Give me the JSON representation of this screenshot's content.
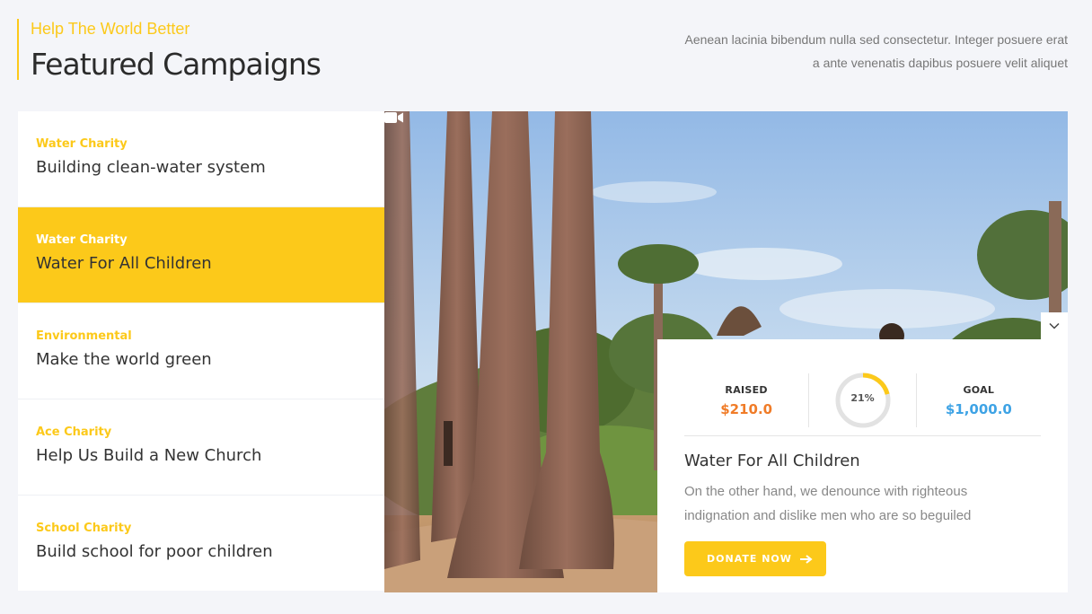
{
  "header": {
    "subtitle": "Help The World Better",
    "title": "Featured Campaigns",
    "description_line1": "Aenean lacinia bibendum nulla sed consectetur. Integer posuere erat",
    "description_line2": "a ante venenatis dapibus posuere velit aliquet"
  },
  "campaigns": [
    {
      "category": "Water Charity",
      "title": "Building clean-water system"
    },
    {
      "category": "Water Charity",
      "title": "Water For All Children"
    },
    {
      "category": "Environmental",
      "title": "Make the world green"
    },
    {
      "category": "Ace Charity",
      "title": "Help Us Build a New Church"
    },
    {
      "category": "School Charity",
      "title": "Build school for poor children"
    }
  ],
  "active_campaign_index": 1,
  "card": {
    "raised_label": "RAISED",
    "raised_value": "$210.0",
    "progress_text": "21%",
    "progress": 0.21,
    "goal_label": "GOAL",
    "goal_value": "$1,000.0",
    "title": "Water For All Children",
    "description": "On the other hand, we denounce with righteous indignation and dislike men who are so beguiled",
    "donate_label": "DONATE NOW"
  },
  "colors": {
    "accent": "#fcc91a",
    "raised": "#f07c28",
    "goal": "#3ea3e5",
    "ring_track": "#e2e2e2"
  },
  "icons": {
    "video": "video-camera-icon",
    "chevron": "chevron-down-icon",
    "arrow": "arrow-right-icon"
  }
}
